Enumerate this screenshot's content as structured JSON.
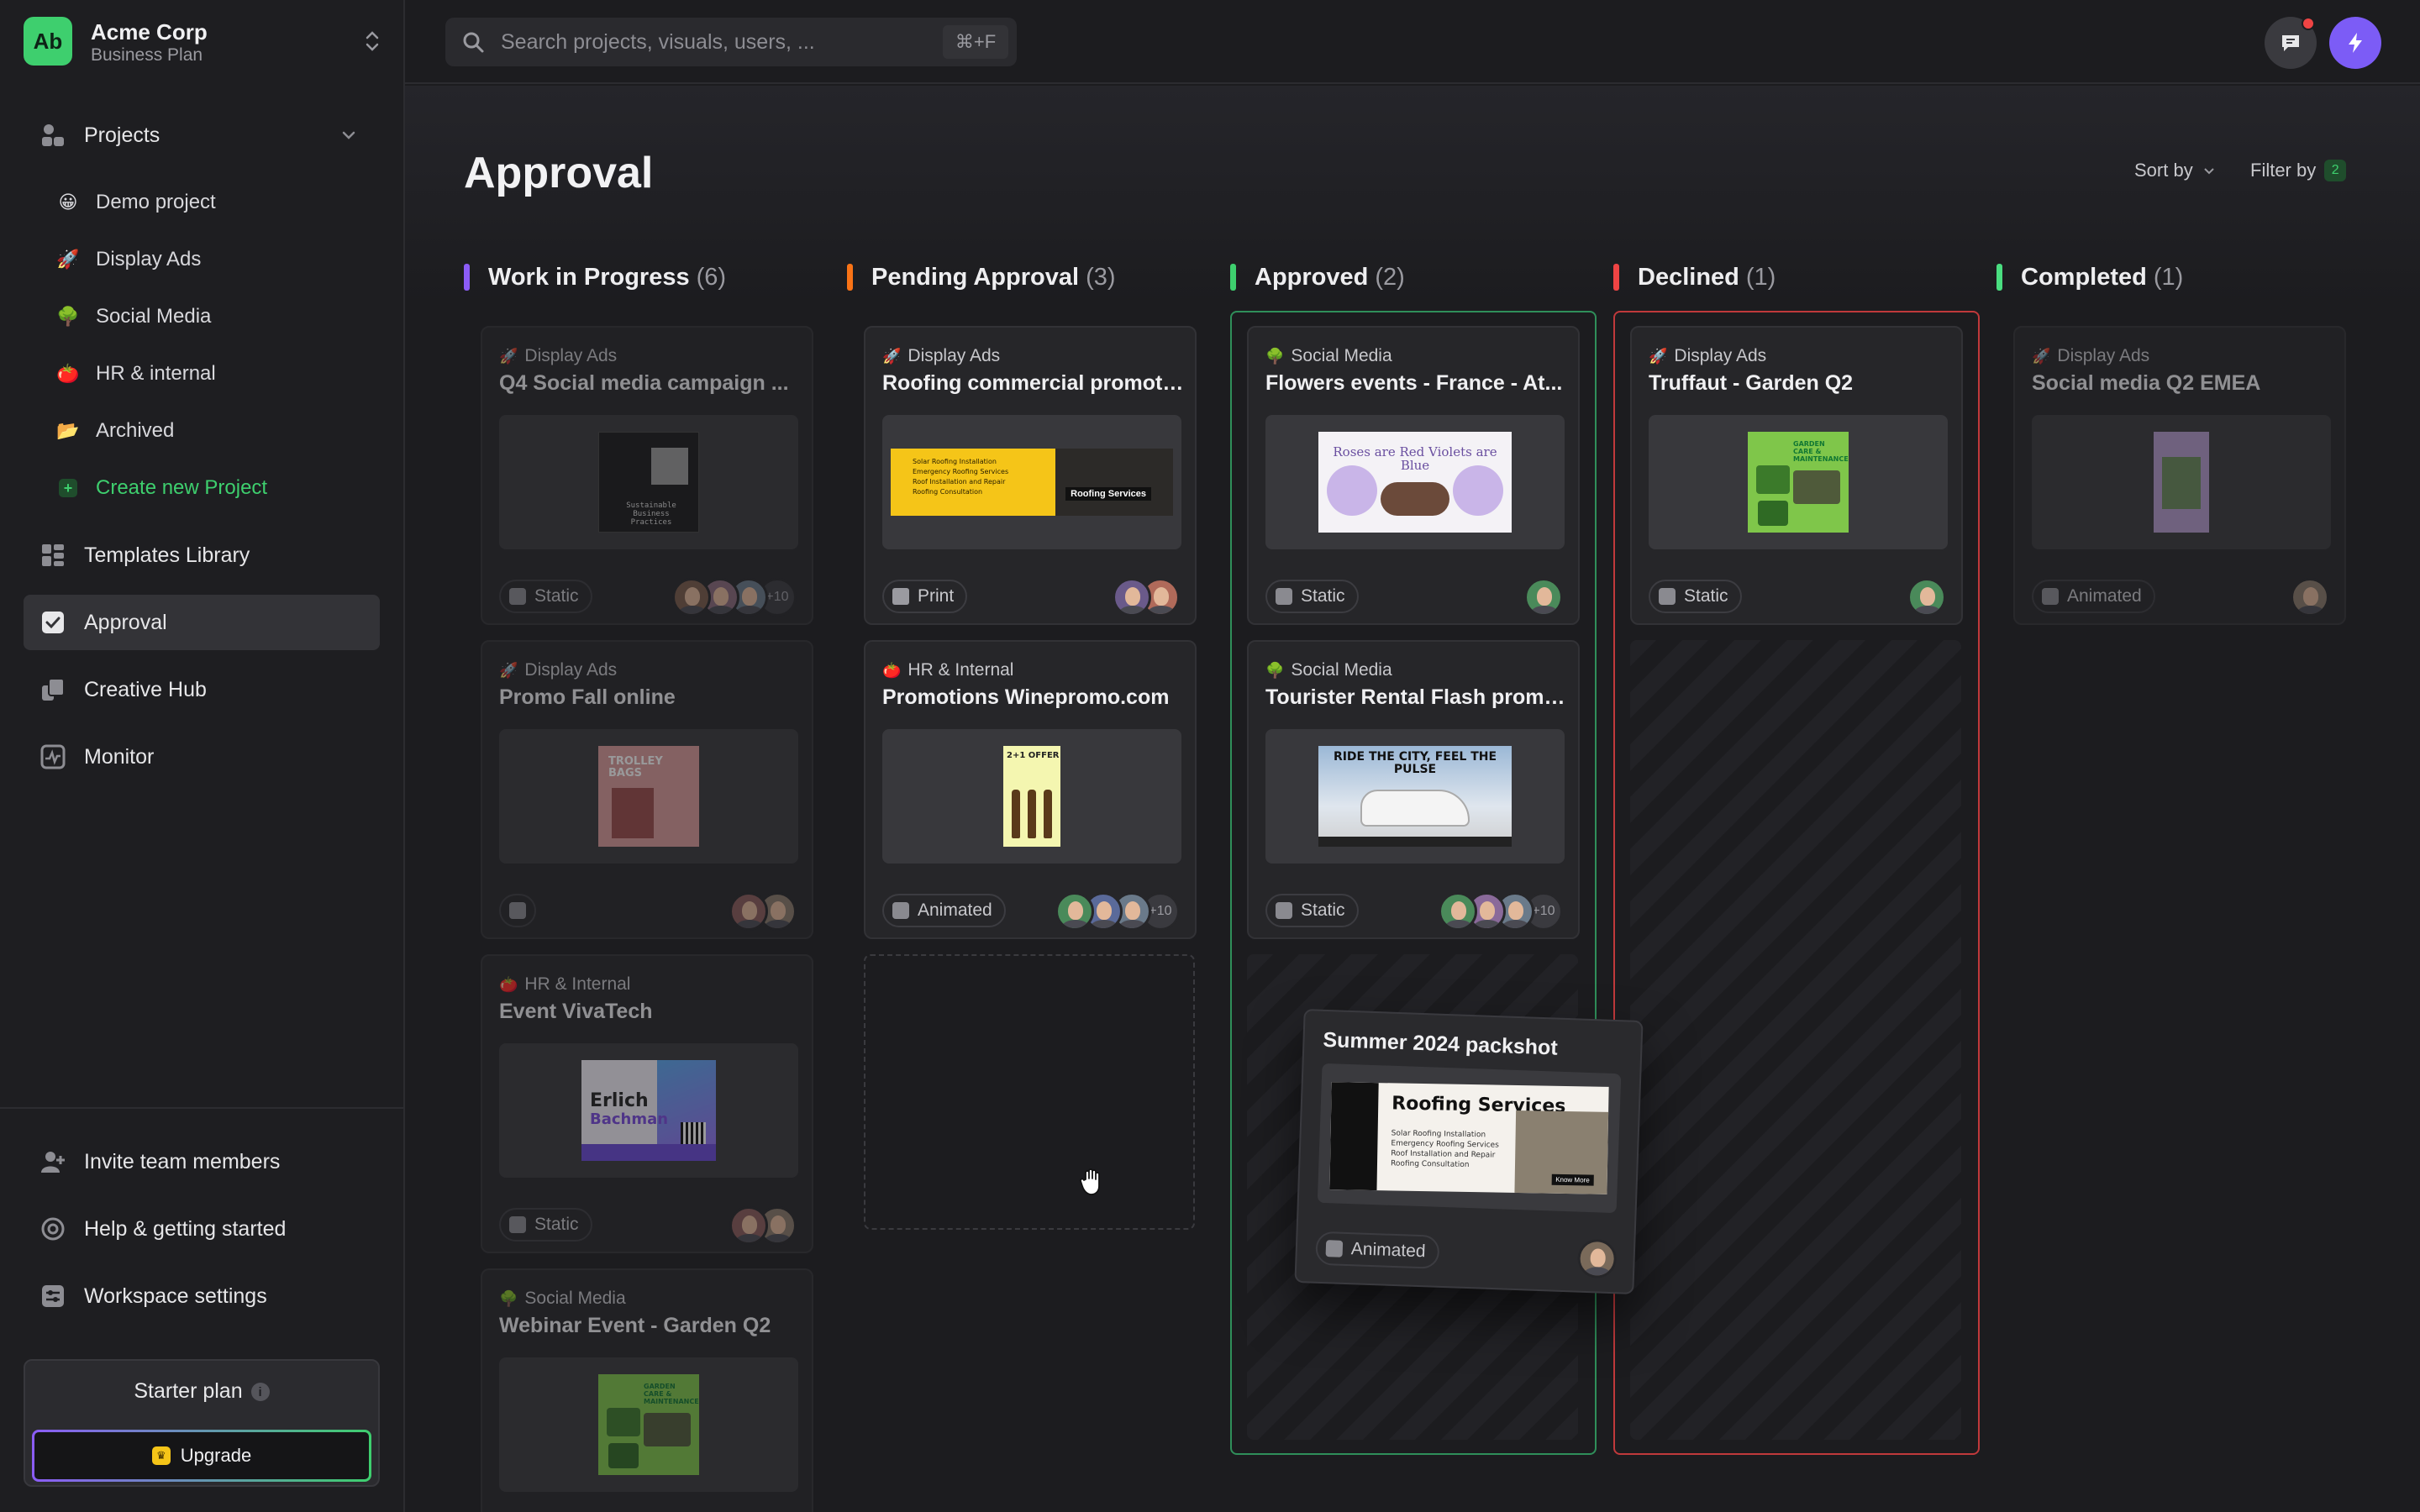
{
  "org": {
    "logo": "Ab",
    "name": "Acme Corp",
    "plan": "Business Plan"
  },
  "nav": {
    "projects": "Projects",
    "project_items": [
      {
        "emoji": "😀",
        "label": "Demo project"
      },
      {
        "emoji": "🚀",
        "label": "Display Ads"
      },
      {
        "emoji": "🌳",
        "label": "Social Media"
      },
      {
        "emoji": "🍅",
        "label": "HR & internal"
      },
      {
        "emoji": "📂",
        "label": "Archived"
      }
    ],
    "create": "Create new Project",
    "templates": "Templates Library",
    "approval": "Approval",
    "creative": "Creative Hub",
    "monitor": "Monitor",
    "invite": "Invite team members",
    "help": "Help & getting started",
    "settings": "Workspace settings"
  },
  "plan_box": {
    "title": "Starter plan",
    "info": "i",
    "upgrade": "Upgrade"
  },
  "search": {
    "placeholder": "Search projects, visuals, users, ...",
    "shortcut": "⌘+F"
  },
  "page": {
    "title": "Approval",
    "sort": "Sort by",
    "filter": "Filter by",
    "filter_count": "2"
  },
  "columns": [
    {
      "title": "Work in Progress",
      "count": "(6)",
      "color": "#8b5cf6"
    },
    {
      "title": "Pending Approval",
      "count": "(3)",
      "color": "#f97316"
    },
    {
      "title": "Approved",
      "count": "(2)",
      "color": "#3ecf6e"
    },
    {
      "title": "Declined",
      "count": "(1)",
      "color": "#ef4444"
    },
    {
      "title": "Completed",
      "count": "(1)",
      "color": "#4ade80"
    }
  ],
  "cards": {
    "wip1": {
      "tag": "Display Ads",
      "tag_emoji": "🚀",
      "title": "Q4 Social media campaign ...",
      "type": "Static",
      "more": "+10",
      "thumb_text": "Sustainable Business Practices"
    },
    "wip2": {
      "tag": "Display Ads",
      "tag_emoji": "🚀",
      "title": "Promo Fall online",
      "thumb_text": "TROLLEY BAGS"
    },
    "wip3": {
      "tag": "HR & Internal",
      "tag_emoji": "🍅",
      "title": "Event VivaTech",
      "type": "Static",
      "thumb_n1": "Erlich",
      "thumb_n2": "Bachman"
    },
    "wip4": {
      "tag": "Social Media",
      "tag_emoji": "🌳",
      "title": "Webinar Event - Garden Q2",
      "thumb_text": "GARDEN CARE & MAINTENANCE"
    },
    "pend1": {
      "tag": "Display Ads",
      "tag_emoji": "🚀",
      "title": "Roofing commercial promoti...",
      "type": "Print",
      "thumb_tag": "Roofing Services",
      "thumb_list": "Solar Roofing Installation\nEmergency Roofing Services\nRoof Installation and Repair\nRoofing Consultation"
    },
    "pend2": {
      "tag": "HR & Internal",
      "tag_emoji": "🍅",
      "title": "Promotions Winepromo.com",
      "type": "Animated",
      "more": "+10",
      "thumb_text": "2+1 OFFER"
    },
    "appr1": {
      "tag": "Social Media",
      "tag_emoji": "🌳",
      "title": "Flowers events - France - At...",
      "type": "Static",
      "thumb_text": "Roses are Red Violets are Blue"
    },
    "appr2": {
      "tag": "Social Media",
      "tag_emoji": "🌳",
      "title": "Tourister Rental Flash promo...",
      "type": "Static",
      "more": "+10",
      "thumb_text": "RIDE THE CITY, FEEL THE PULSE"
    },
    "decl1": {
      "tag": "Display Ads",
      "tag_emoji": "🚀",
      "title": "Truffaut - Garden Q2",
      "type": "Static",
      "thumb_text": "GARDEN CARE & MAINTENANCE"
    },
    "comp1": {
      "tag": "Display Ads",
      "tag_emoji": "🚀",
      "title": "Social media Q2 EMEA",
      "type": "Animated"
    }
  },
  "dragging": {
    "title": "Summer 2024 packshot",
    "type": "Animated",
    "thumb_heading": "Roofing Services",
    "thumb_btn": "Know More"
  },
  "colors": {
    "accent_green": "#3ecf6e",
    "accent_purple": "#7c5cf6",
    "bg": "#1c1c1f"
  }
}
